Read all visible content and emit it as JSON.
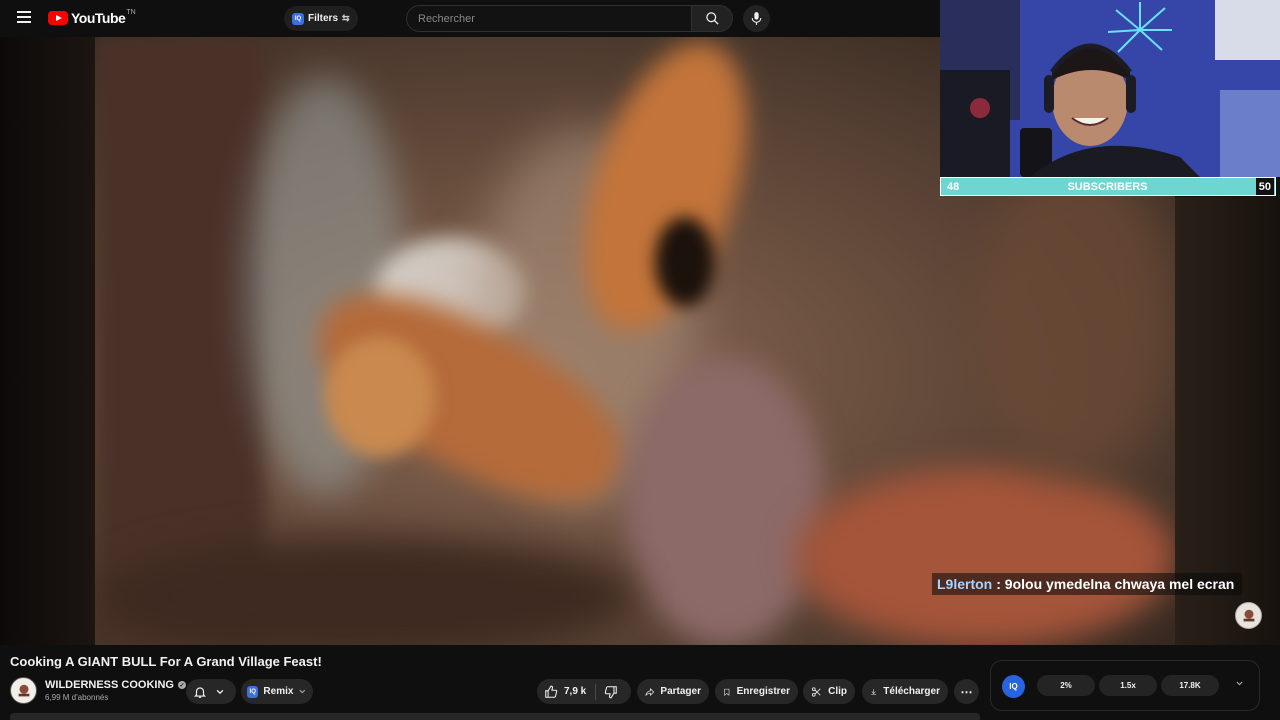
{
  "header": {
    "logo_text": "YouTube",
    "logo_sup": "TN",
    "filters_label": "Filters",
    "filters_badge": "IQ",
    "search_placeholder": "Rechercher"
  },
  "overlay": {
    "chat_user": "L9lerton",
    "chat_message": ": 9olou ymedelna chwaya mel ecran",
    "subscribers_label": "SUBSCRIBERS",
    "subscribers_start": "48",
    "subscribers_goal": "50"
  },
  "video": {
    "title": "Cooking A GIANT BULL For A Grand Village Feast!",
    "channel_name": "WILDERNESS COOKING",
    "channel_subscribers": "6,99 M d'abonnés"
  },
  "actions": {
    "remix_label": "Remix",
    "remix_badge": "IQ",
    "likes": "7,9 k",
    "share_label": "Partager",
    "save_label": "Enregistrer",
    "clip_label": "Clip",
    "download_label": "Télécharger",
    "more_label": "⋯"
  },
  "iq_panel": {
    "logo": "IQ",
    "stats": [
      "2%",
      "1.5x",
      "17.8K"
    ]
  },
  "colors": {
    "brand_red": "#ff0000",
    "iq_blue": "#2a63e0",
    "subscribers_bar": "#6fd5d0",
    "chat_user": "#a9d3ff"
  },
  "icons": [
    "menu-icon",
    "search-icon",
    "mic-icon",
    "bell-icon",
    "chevron-down-icon",
    "thumbs-up-icon",
    "thumbs-down-icon",
    "share-icon",
    "bookmark-icon",
    "scissors-icon",
    "download-icon",
    "more-icon",
    "verified-icon"
  ]
}
